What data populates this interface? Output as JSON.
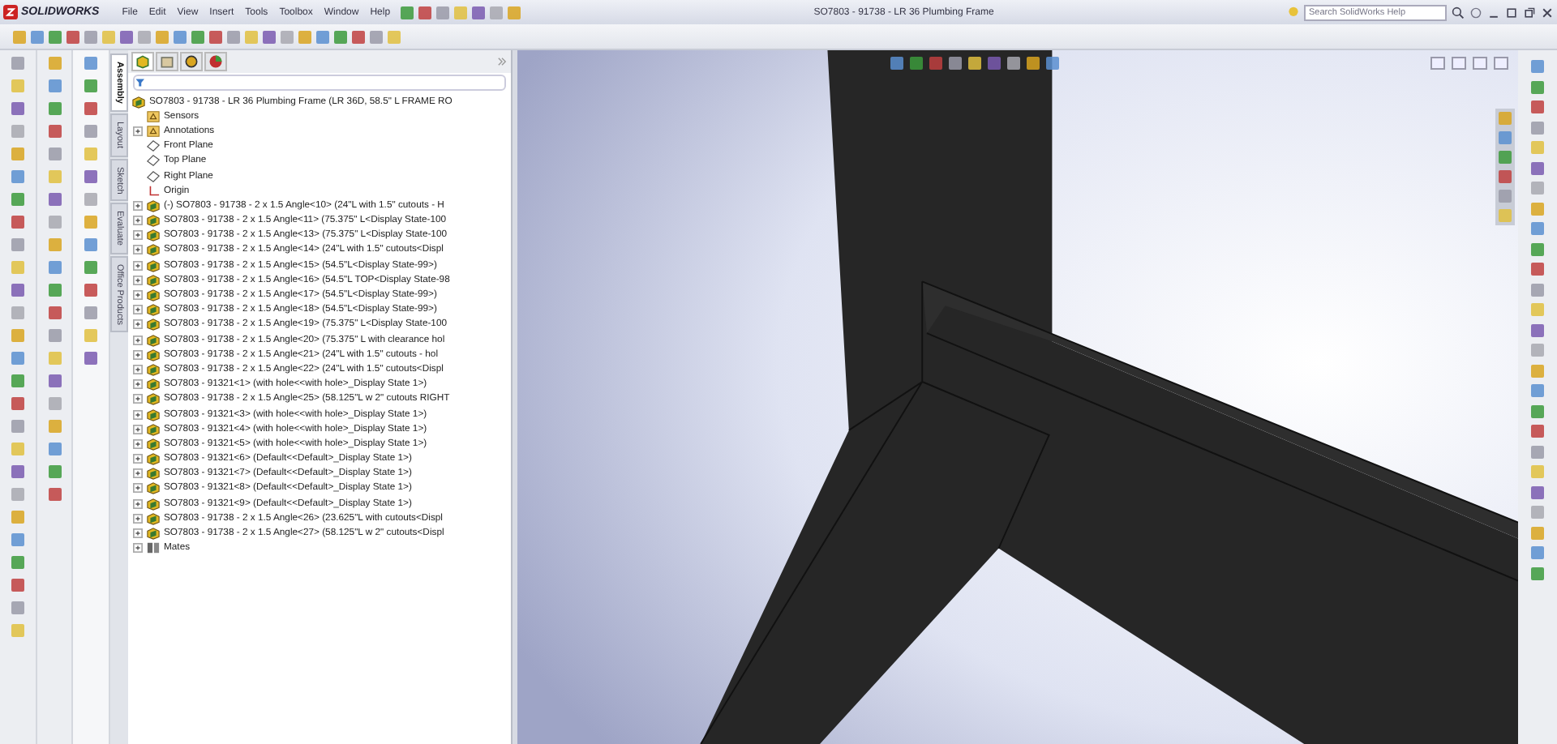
{
  "app_logo": "SOLIDWORKS",
  "menu": [
    "File",
    "Edit",
    "View",
    "Insert",
    "Tools",
    "Toolbox",
    "Window",
    "Help"
  ],
  "window": {
    "title": "SO7803 - 91738 - LR 36 Plumbing Frame"
  },
  "search": {
    "placeholder": "Search SolidWorks Help"
  },
  "command_tabs": [
    {
      "label": "Assembly",
      "selected": true
    },
    {
      "label": "Layout",
      "selected": false
    },
    {
      "label": "Sketch",
      "selected": false
    },
    {
      "label": "Evaluate",
      "selected": false
    },
    {
      "label": "Office Products",
      "selected": false
    }
  ],
  "tree": {
    "label": "SO7803 - 91738 - LR 36 Plumbing Frame  (LR 36D, 58.5\" L FRAME RO",
    "kind": "assembly",
    "children": [
      {
        "label": "Sensors",
        "kind": "sensors",
        "expander": false
      },
      {
        "label": "Annotations",
        "kind": "annotations",
        "expander": true
      },
      {
        "label": "Front Plane",
        "kind": "plane",
        "expander": false
      },
      {
        "label": "Top Plane",
        "kind": "plane",
        "expander": false
      },
      {
        "label": "Right Plane",
        "kind": "plane",
        "expander": false
      },
      {
        "label": "Origin",
        "kind": "origin",
        "expander": false
      },
      {
        "label": "(-) SO7803 - 91738 - 2 x 1.5 Angle<10> (24\"L with 1.5\" cutouts - H",
        "kind": "component",
        "expander": true
      },
      {
        "label": "SO7803 - 91738 - 2 x 1.5 Angle<11> (75.375\" L<Display State-100",
        "kind": "component",
        "expander": true
      },
      {
        "label": "SO7803 - 91738 - 2 x 1.5 Angle<13> (75.375\" L<Display State-100",
        "kind": "component",
        "expander": true
      },
      {
        "label": "SO7803 - 91738 - 2 x 1.5 Angle<14> (24\"L with 1.5\" cutouts<Displ",
        "kind": "component",
        "expander": true
      },
      {
        "label": "SO7803 - 91738 - 2 x 1.5 Angle<15> (54.5\"L<Display State-99>)",
        "kind": "component",
        "expander": true
      },
      {
        "label": "SO7803 - 91738 - 2 x 1.5 Angle<16> (54.5\"L TOP<Display State-98",
        "kind": "component",
        "expander": true
      },
      {
        "label": "SO7803 - 91738 - 2 x 1.5 Angle<17> (54.5\"L<Display State-99>)",
        "kind": "component",
        "expander": true
      },
      {
        "label": "SO7803 - 91738 - 2 x 1.5 Angle<18> (54.5\"L<Display State-99>)",
        "kind": "component",
        "expander": true
      },
      {
        "label": "SO7803 - 91738 - 2 x 1.5 Angle<19> (75.375\" L<Display State-100",
        "kind": "component",
        "expander": true
      },
      {
        "label": "SO7803 - 91738 - 2 x 1.5 Angle<20> (75.375\" L with clearance hol",
        "kind": "component",
        "expander": true
      },
      {
        "label": "SO7803 - 91738 - 2 x 1.5 Angle<21> (24\"L with 1.5\" cutouts - hol",
        "kind": "component",
        "expander": true
      },
      {
        "label": "SO7803 - 91738 - 2 x 1.5 Angle<22> (24\"L with 1.5\" cutouts<Displ",
        "kind": "component",
        "expander": true
      },
      {
        "label": "SO7803 - 91321<1> (with hole<<with hole>_Display State 1>)",
        "kind": "component",
        "expander": true
      },
      {
        "label": "SO7803 - 91738 - 2 x 1.5 Angle<25> (58.125\"L w 2\" cutouts RIGHT",
        "kind": "component",
        "expander": true
      },
      {
        "label": "SO7803 - 91321<3> (with hole<<with hole>_Display State 1>)",
        "kind": "component",
        "expander": true
      },
      {
        "label": "SO7803 - 91321<4> (with hole<<with hole>_Display State 1>)",
        "kind": "component",
        "expander": true
      },
      {
        "label": "SO7803 - 91321<5> (with hole<<with hole>_Display State 1>)",
        "kind": "component",
        "expander": true
      },
      {
        "label": "SO7803 - 91321<6> (Default<<Default>_Display State 1>)",
        "kind": "component",
        "expander": true
      },
      {
        "label": "SO7803 - 91321<7> (Default<<Default>_Display State 1>)",
        "kind": "component",
        "expander": true
      },
      {
        "label": "SO7803 - 91321<8> (Default<<Default>_Display State 1>)",
        "kind": "component",
        "expander": true
      },
      {
        "label": "SO7803 - 91321<9> (Default<<Default>_Display State 1>)",
        "kind": "component",
        "expander": true
      },
      {
        "label": "SO7803 - 91738 - 2 x 1.5 Angle<26> (23.625\"L with cutouts<Displ",
        "kind": "component",
        "expander": true
      },
      {
        "label": "SO7803 - 91738 - 2 x 1.5 Angle<27> (58.125\"L w 2\" cutouts<Displ",
        "kind": "component",
        "expander": true
      },
      {
        "label": "Mates",
        "kind": "mates",
        "expander": true
      }
    ]
  }
}
